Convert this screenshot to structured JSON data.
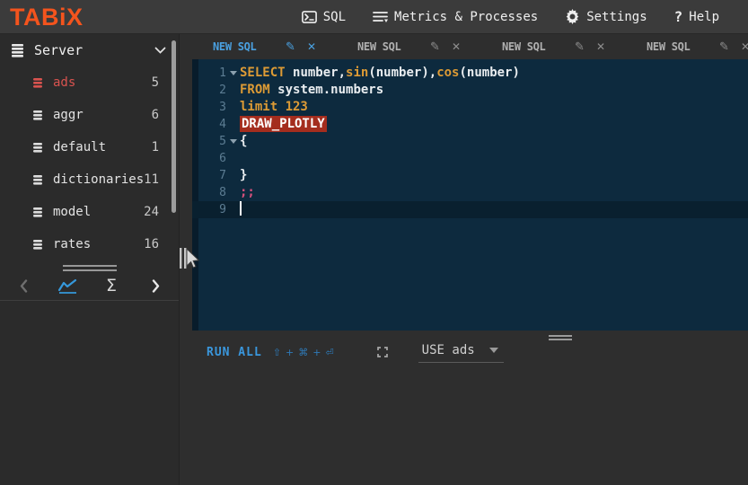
{
  "header": {
    "logo": "TABiX",
    "nav": [
      {
        "label": "SQL",
        "icon": "terminal-icon"
      },
      {
        "label": "Metrics & Processes",
        "icon": "list-icon"
      },
      {
        "label": "Settings",
        "icon": "gear-icon"
      },
      {
        "label": "Help",
        "icon": "help-icon"
      }
    ]
  },
  "sidebar": {
    "server_label": "Server",
    "databases": [
      {
        "name": "ads",
        "count": "5",
        "active": true
      },
      {
        "name": "aggr",
        "count": "6",
        "active": false
      },
      {
        "name": "default",
        "count": "1",
        "active": false
      },
      {
        "name": "dictionaries",
        "count": "11",
        "active": false
      },
      {
        "name": "model",
        "count": "24",
        "active": false
      },
      {
        "name": "rates",
        "count": "16",
        "active": false
      }
    ]
  },
  "tabs": [
    {
      "label": "NEW SQL",
      "active": true
    },
    {
      "label": "NEW SQL",
      "active": false
    },
    {
      "label": "NEW SQL",
      "active": false
    },
    {
      "label": "NEW SQL",
      "active": false
    }
  ],
  "editor": {
    "lines": [
      {
        "num": "1",
        "fold": true,
        "active": false,
        "cursor": false,
        "segments": [
          {
            "text": "SELECT ",
            "type": "kw"
          },
          {
            "text": "number,",
            "type": "pl"
          },
          {
            "text": "sin",
            "type": "kw"
          },
          {
            "text": "(number),",
            "type": "pl"
          },
          {
            "text": "cos",
            "type": "kw"
          },
          {
            "text": "(number)",
            "type": "pl"
          }
        ]
      },
      {
        "num": "2",
        "fold": false,
        "active": false,
        "cursor": false,
        "segments": [
          {
            "text": "FROM ",
            "type": "kw"
          },
          {
            "text": "system.numbers",
            "type": "pl"
          }
        ]
      },
      {
        "num": "3",
        "fold": false,
        "active": false,
        "cursor": false,
        "segments": [
          {
            "text": "limit ",
            "type": "kw"
          },
          {
            "text": "123",
            "type": "num"
          }
        ]
      },
      {
        "num": "4",
        "fold": false,
        "active": false,
        "cursor": false,
        "segments": [
          {
            "text": "DRAW_PLOTLY",
            "type": "draw"
          }
        ]
      },
      {
        "num": "5",
        "fold": true,
        "active": false,
        "cursor": false,
        "segments": [
          {
            "text": "{",
            "type": "pl"
          }
        ]
      },
      {
        "num": "6",
        "fold": false,
        "active": false,
        "cursor": false,
        "segments": []
      },
      {
        "num": "7",
        "fold": false,
        "active": false,
        "cursor": false,
        "segments": [
          {
            "text": "}",
            "type": "pl"
          }
        ]
      },
      {
        "num": "8",
        "fold": false,
        "active": false,
        "cursor": false,
        "segments": [
          {
            "text": ";;",
            "type": "semi"
          }
        ]
      },
      {
        "num": "9",
        "fold": false,
        "active": true,
        "cursor": true,
        "segments": []
      }
    ]
  },
  "toolbar": {
    "run_label": "RUN ALL",
    "shortcut": [
      "⇧",
      "+",
      "⌘",
      "+",
      "⏎"
    ],
    "use_label": "USE ads"
  },
  "colors": {
    "logo_orange": "#f4541d",
    "active_tab_blue": "#4aa0e0",
    "run_blue": "#3a97dd",
    "chart_icon_blue": "#3598db",
    "active_db_red": "#d9534f",
    "editor_bg": "#0d2a3e",
    "keyword_orange": "#dd9b35",
    "semicolon_pink": "#d6517c",
    "draw_command_bg": "#a42d1e"
  }
}
